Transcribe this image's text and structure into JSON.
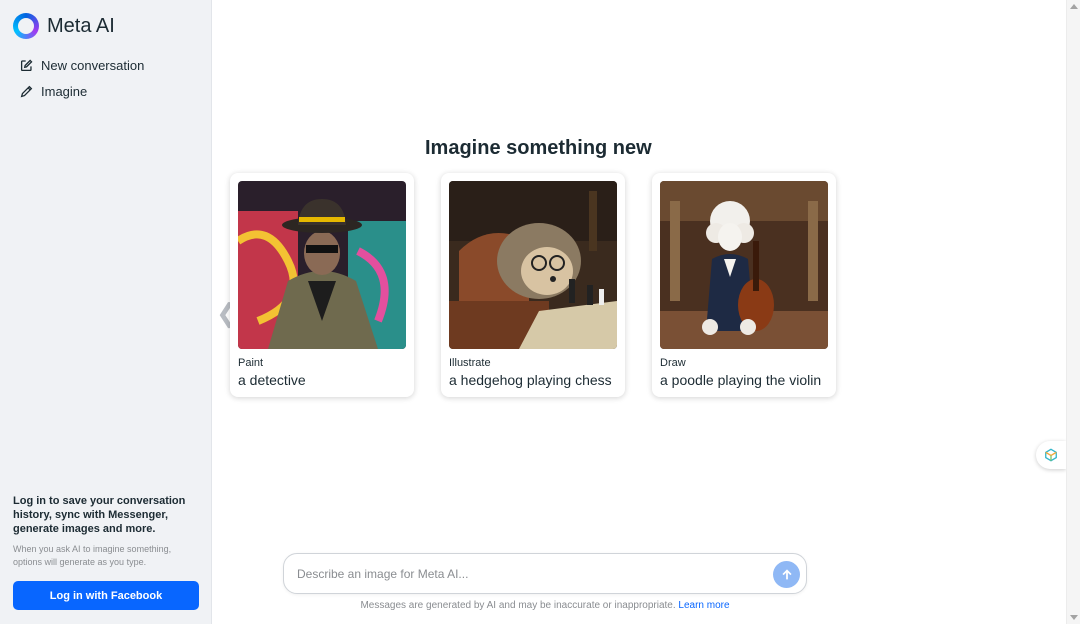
{
  "sidebar": {
    "brand": "Meta AI",
    "nav": [
      {
        "label": "New conversation",
        "icon": "edit-icon"
      },
      {
        "label": "Imagine",
        "icon": "pencil-icon"
      }
    ],
    "login_title": "Log in to save your conversation history, sync with Messenger, generate images and more.",
    "login_subtitle": "When you ask AI to imagine something, options will generate as you type.",
    "login_button": "Log in with Facebook"
  },
  "main": {
    "heading": "Imagine something new",
    "cards": [
      {
        "kind": "Paint",
        "subject": "a detective"
      },
      {
        "kind": "Illustrate",
        "subject": "a hedgehog playing chess"
      },
      {
        "kind": "Draw",
        "subject": "a poodle playing the violin"
      }
    ]
  },
  "composer": {
    "placeholder": "Describe an image for Meta AI..."
  },
  "footer": {
    "disclaimer": "Messages are generated by AI and may be inaccurate or inappropriate.",
    "learn_more": "Learn more"
  },
  "colors": {
    "accent": "#0866ff",
    "sidebar_bg": "#f0f2f5",
    "send_button": "#8fb8f5"
  }
}
